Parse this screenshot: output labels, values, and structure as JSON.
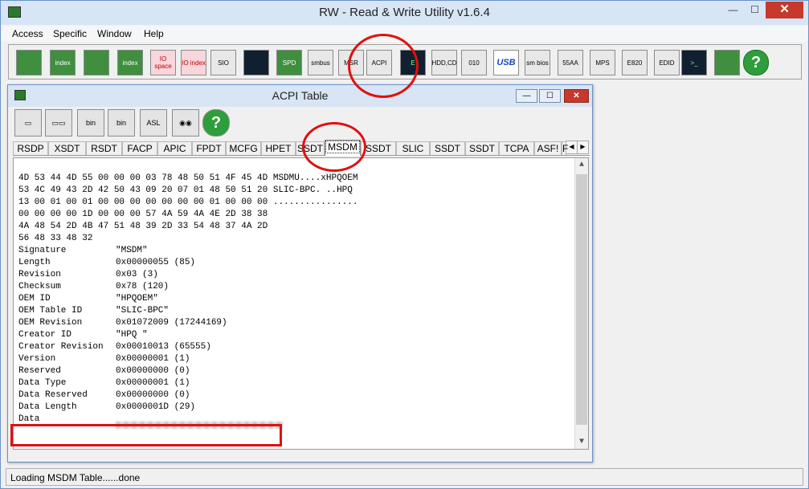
{
  "window": {
    "title": "RW - Read & Write Utility v1.6.4",
    "minimize": "—",
    "maximize": "☐",
    "close": "✕"
  },
  "menu": [
    "Access",
    "Specific",
    "Window",
    "Help"
  ],
  "toolbar": {
    "buttons": [
      {
        "name": "pci-button",
        "label": "",
        "style": "tb-chip"
      },
      {
        "name": "pci-index-button",
        "label": "index",
        "style": "tb-chip"
      },
      {
        "name": "memory-button",
        "label": "",
        "style": "tb-chip"
      },
      {
        "name": "memory-index-button",
        "label": "index",
        "style": "tb-chip"
      },
      {
        "name": "io-space-button",
        "label": "IO space",
        "style": "tb-pink"
      },
      {
        "name": "io-index-button",
        "label": "IO index",
        "style": "tb-pink"
      },
      {
        "name": "sio-button",
        "label": "SIO",
        "style": ""
      },
      {
        "name": "oscilloscope-button",
        "label": "",
        "style": "tb-dark"
      },
      {
        "name": "spd-button",
        "label": "SPD",
        "style": "tb-chip"
      },
      {
        "name": "smbus-button",
        "label": "smbus",
        "style": ""
      },
      {
        "name": "msr-button",
        "label": "MSR",
        "style": ""
      },
      {
        "name": "acpi-button",
        "label": "ACPI",
        "style": ""
      },
      {
        "name": "ec-button",
        "label": "E",
        "style": "tb-dark"
      },
      {
        "name": "hdd-cd-button",
        "label": "HDD,CD",
        "style": ""
      },
      {
        "name": "010-button",
        "label": "010",
        "style": ""
      },
      {
        "name": "usb-button",
        "label": "USB",
        "style": "tb-usb"
      },
      {
        "name": "smbios-button",
        "label": "sm bios",
        "style": ""
      },
      {
        "name": "55aa-button",
        "label": "55AA",
        "style": ""
      },
      {
        "name": "mps-button",
        "label": "MPS",
        "style": ""
      },
      {
        "name": "e820-button",
        "label": "E820",
        "style": ""
      },
      {
        "name": "edid-button",
        "label": "EDID",
        "style": ""
      },
      {
        "name": "command-prompt-button",
        "label": ">_",
        "style": "tb-dark"
      },
      {
        "name": "battery-button",
        "label": "",
        "style": "tb-chip"
      },
      {
        "name": "help-button",
        "label": "?",
        "style": "tb-help"
      }
    ]
  },
  "acpi_window": {
    "title": "ACPI Table",
    "toolbar": [
      {
        "name": "save-icon",
        "label": "▭"
      },
      {
        "name": "save-all-icon",
        "label": "▭▭"
      },
      {
        "name": "save-bin-icon",
        "label": "bin"
      },
      {
        "name": "save-all-bin-icon",
        "label": "bin"
      },
      {
        "name": "asl-icon",
        "label": "ASL"
      },
      {
        "name": "binoculars-icon",
        "label": "◉◉"
      },
      {
        "name": "help-icon",
        "label": "?"
      }
    ],
    "tabs": [
      "RSDP",
      "XSDT",
      "RSDT",
      "FACP",
      "APIC",
      "FPDT",
      "MCFG",
      "HPET",
      "SSDT",
      "MSDM",
      "SSDT",
      "SLIC",
      "SSDT",
      "SSDT",
      "TCPA",
      "ASF!",
      "F"
    ],
    "active_tab": "MSDM",
    "hex_lines": [
      "4D 53 44 4D 55 00 00 00 03 78 48 50 51 4F 45 4D MSDMU....xHPQOEM",
      "53 4C 49 43 2D 42 50 43 09 20 07 01 48 50 51 20 SLIC-BPC. ..HPQ",
      "13 00 01 00 01 00 00 00 00 00 00 00 01 00 00 00 ................",
      "00 00 00 00 1D 00 00 00 57 4A 59 4A 4E 2D 38 38",
      "4A 48 54 2D 4B 47 51 48 39 2D 33 54 48 37 4A 2D",
      "56 48 33 48 32"
    ],
    "fields": [
      {
        "name": "Signature",
        "value": "\"MSDM\""
      },
      {
        "name": "Length",
        "value": "0x00000055 (85)"
      },
      {
        "name": "Revision",
        "value": "0x03 (3)"
      },
      {
        "name": "Checksum",
        "value": "0x78 (120)"
      },
      {
        "name": "OEM ID",
        "value": "\"HPQOEM\""
      },
      {
        "name": "OEM Table ID",
        "value": "\"SLIC-BPC\""
      },
      {
        "name": "OEM Revision",
        "value": "0x01072009 (17244169)"
      },
      {
        "name": "Creator ID",
        "value": "\"HPQ \""
      },
      {
        "name": "Creator Revision",
        "value": "0x00010013 (65555)"
      },
      {
        "name": "Version",
        "value": "0x00000001 (1)"
      },
      {
        "name": "Reserved",
        "value": "0x00000000 (0)"
      },
      {
        "name": "Data Type",
        "value": "0x00000001 (1)"
      },
      {
        "name": "Data Reserved",
        "value": "0x00000000 (0)"
      },
      {
        "name": "Data Length",
        "value": "0x0000001D (29)"
      },
      {
        "name": "Data",
        "value": ""
      }
    ]
  },
  "status": "Loading MSDM Table......done",
  "colors": {
    "highlight": "#e01010",
    "accent": "#6b91c9"
  }
}
